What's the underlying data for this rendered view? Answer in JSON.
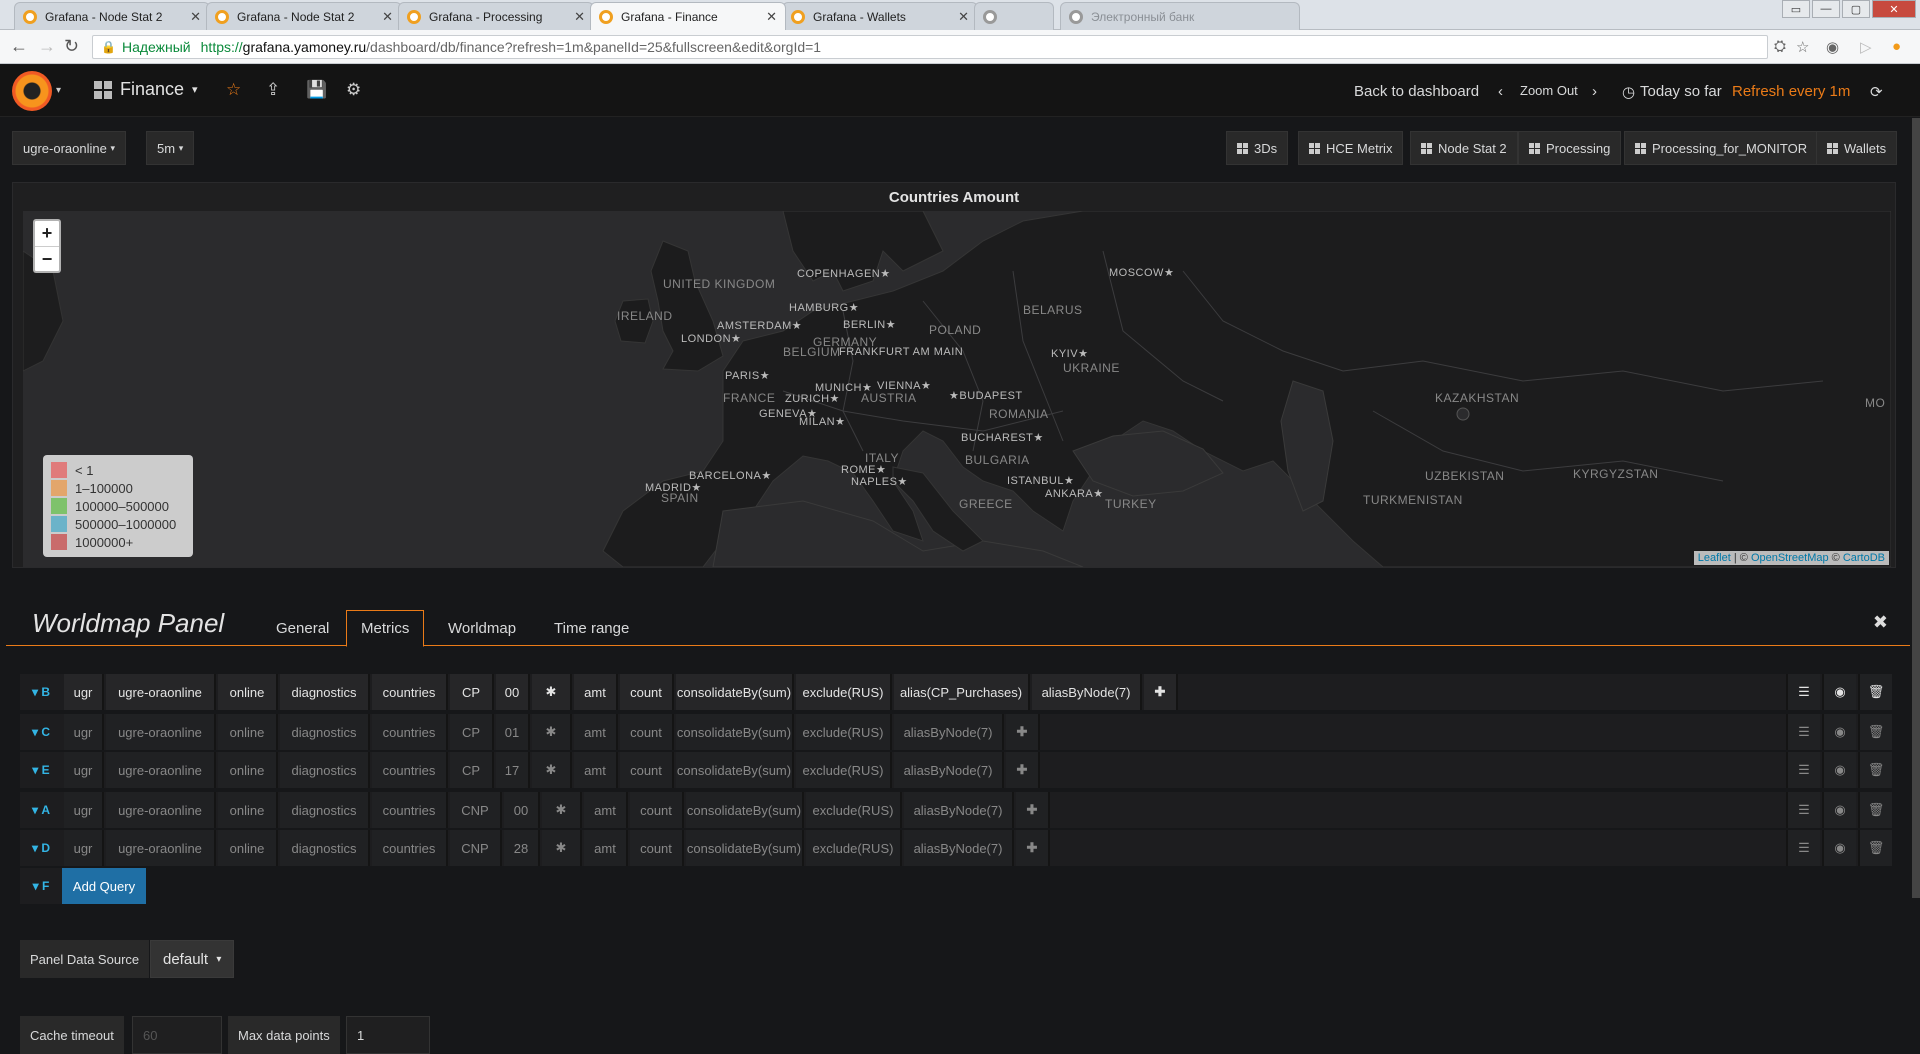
{
  "browser": {
    "tabs": [
      {
        "title": "Grafana - Node Stat 2"
      },
      {
        "title": "Grafana - Node Stat 2"
      },
      {
        "title": "Grafana - Processing"
      },
      {
        "title": "Grafana - Finance"
      },
      {
        "title": "Grafana - Wallets"
      },
      {
        "title": ""
      },
      {
        "title": "Электронный банк"
      }
    ],
    "active_tab": 3,
    "secure_label": "Надежный",
    "url_proto": "https://",
    "url_host": "grafana.yamoney.ru",
    "url_path": "/dashboard/db/finance?refresh=1m&panelId=25&fullscreen&edit&orgId=1"
  },
  "nav": {
    "dashboard_title": "Finance",
    "back_label": "Back to dashboard",
    "zoom_out_label": "Zoom Out",
    "time_label": "Today so far",
    "refresh_label": "Refresh every 1m"
  },
  "variables": {
    "host": "ugre-oraonline",
    "interval": "5m"
  },
  "dashboard_links": [
    "3Ds",
    "HCE Metrix",
    "Node Stat 2",
    "Processing",
    "Processing_for_MONITOR",
    "Wallets"
  ],
  "panel": {
    "title": "Countries Amount",
    "labels": {
      "cities": [
        "COPENHAGEN★",
        "MOSCOW★",
        "HAMBURG★",
        "BERLIN★",
        "AMSTERDAM★",
        "LONDON★",
        "FRANKFURT AM MAIN",
        "KYIV★",
        "PARIS★",
        "MUNICH★",
        "VIENNA★",
        "★BUDAPEST",
        "ZURICH★",
        "GENEVA★",
        "MILAN★",
        "BUCHAREST★",
        "BARCELONA★",
        "ROME★",
        "NAPLES★",
        "ISTANBUL★",
        "MADRID★",
        "ANKARA★"
      ],
      "countries": [
        "UNITED KINGDOM",
        "IRELAND",
        "BELARUS",
        "POLAND",
        "GERMANY",
        "BELGIUM",
        "UKRAINE",
        "FRANCE",
        "AUSTRIA",
        "ROMANIA",
        "KAZAKHSTAN",
        "ITALY",
        "BULGARIA",
        "SPAIN",
        "UZBEKISTAN",
        "KYRGYZSTAN",
        "TURKMENISTAN",
        "TURKEY",
        "GREECE",
        "MO"
      ]
    },
    "zoom_in": "+",
    "zoom_out": "−",
    "legend": [
      {
        "label": "< 1",
        "color": "#e07b7b"
      },
      {
        "label": "1–100000",
        "color": "#e3a66b"
      },
      {
        "label": "100000–500000",
        "color": "#7ec26b"
      },
      {
        "label": "500000–1000000",
        "color": "#6bb3c9"
      },
      {
        "label": "1000000+",
        "color": "#c96b6b"
      }
    ],
    "attribution_leaflet": "Leaflet",
    "attribution_sep": " | © ",
    "attribution_osm": "OpenStreetMap",
    "attribution_sep2": " © ",
    "attribution_carto": "CartoDB"
  },
  "editor": {
    "title": "Worldmap Panel",
    "tabs": [
      "General",
      "Metrics",
      "Worldmap",
      "Time range"
    ],
    "active_tab": 1,
    "queries": [
      {
        "ref": "B",
        "segments": [
          "ugr",
          "ugre-oraonline",
          "online",
          "diagnostics",
          "countries",
          "CP",
          "00",
          "✱",
          "amt",
          "count",
          "consolidateBy(sum)",
          "exclude(RUS)",
          "alias(CP_Purchases)",
          "aliasByNode(7)"
        ]
      },
      {
        "ref": "C",
        "segments": [
          "ugr",
          "ugre-oraonline",
          "online",
          "diagnostics",
          "countries",
          "CP",
          "01",
          "✱",
          "amt",
          "count",
          "consolidateBy(sum)",
          "exclude(RUS)",
          "aliasByNode(7)"
        ]
      },
      {
        "ref": "E",
        "segments": [
          "ugr",
          "ugre-oraonline",
          "online",
          "diagnostics",
          "countries",
          "CP",
          "17",
          "✱",
          "amt",
          "count",
          "consolidateBy(sum)",
          "exclude(RUS)",
          "aliasByNode(7)"
        ]
      },
      {
        "ref": "A",
        "segments": [
          "ugr",
          "ugre-oraonline",
          "online",
          "diagnostics",
          "countries",
          "CNP",
          "00",
          "✱",
          "amt",
          "count",
          "consolidateBy(sum)",
          "exclude(RUS)",
          "aliasByNode(7)"
        ]
      },
      {
        "ref": "D",
        "segments": [
          "ugr",
          "ugre-oraonline",
          "online",
          "diagnostics",
          "countries",
          "CNP",
          "28",
          "✱",
          "amt",
          "count",
          "consolidateBy(sum)",
          "exclude(RUS)",
          "aliasByNode(7)"
        ]
      }
    ],
    "add_query_ref": "F",
    "add_query_label": "Add Query",
    "panel_data_source_label": "Panel Data Source",
    "panel_data_source_value": "default",
    "cache_timeout_label": "Cache timeout",
    "cache_timeout_placeholder": "60",
    "max_data_points_label": "Max data points",
    "max_data_points_value": "1"
  }
}
